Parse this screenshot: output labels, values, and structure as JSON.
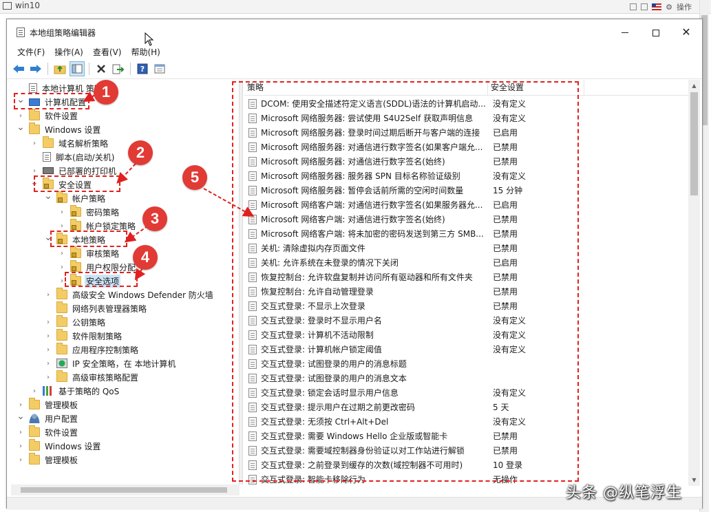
{
  "host": {
    "title": "win10",
    "menu_label": "操作"
  },
  "window": {
    "title": "本地组策略编辑器",
    "close_glyph": "✕"
  },
  "menu": [
    "文件(F)",
    "操作(A)",
    "查看(V)",
    "帮助(H)"
  ],
  "toolbar_icons": [
    "back-arrow-icon",
    "forward-arrow-icon",
    "up-folder-icon",
    "show-hide-tree-icon",
    "delete-icon",
    "export-icon",
    "help-icon",
    "properties-icon"
  ],
  "tree": [
    {
      "label": "本地计算机 策略",
      "depth": 0,
      "tw": "",
      "icon": "doc"
    },
    {
      "label": "计算机配置",
      "depth": 0,
      "tw": "v",
      "icon": "pc"
    },
    {
      "label": "软件设置",
      "depth": 1,
      "tw": ">",
      "icon": "folder"
    },
    {
      "label": "Windows 设置",
      "depth": 1,
      "tw": "v",
      "icon": "folder"
    },
    {
      "label": "域名解析策略",
      "depth": 2,
      "tw": ">",
      "icon": "folder"
    },
    {
      "label": "脚本(启动/关机)",
      "depth": 2,
      "tw": "",
      "icon": "doc"
    },
    {
      "label": "已部署的打印机",
      "depth": 2,
      "tw": ">",
      "icon": "printer"
    },
    {
      "label": "安全设置",
      "depth": 2,
      "tw": "v",
      "icon": "lockfold"
    },
    {
      "label": "帐户策略",
      "depth": 3,
      "tw": "v",
      "icon": "lockfold"
    },
    {
      "label": "密码策略",
      "depth": 4,
      "tw": ">",
      "icon": "lockfold"
    },
    {
      "label": "帐户锁定策略",
      "depth": 4,
      "tw": ">",
      "icon": "lockfold"
    },
    {
      "label": "本地策略",
      "depth": 3,
      "tw": "v",
      "icon": "lockfold"
    },
    {
      "label": "审核策略",
      "depth": 4,
      "tw": ">",
      "icon": "lockfold"
    },
    {
      "label": "用户权限分配",
      "depth": 4,
      "tw": ">",
      "icon": "lockfold"
    },
    {
      "label": "安全选项",
      "depth": 4,
      "tw": ">",
      "icon": "lockfold"
    },
    {
      "label": "高级安全 Windows Defender 防火墙",
      "depth": 3,
      "tw": ">",
      "icon": "folder"
    },
    {
      "label": "网络列表管理器策略",
      "depth": 3,
      "tw": "",
      "icon": "folder"
    },
    {
      "label": "公钥策略",
      "depth": 3,
      "tw": ">",
      "icon": "folder"
    },
    {
      "label": "软件限制策略",
      "depth": 3,
      "tw": ">",
      "icon": "folder"
    },
    {
      "label": "应用程序控制策略",
      "depth": 3,
      "tw": ">",
      "icon": "folder"
    },
    {
      "label": "IP 安全策略，在 本地计算机",
      "depth": 3,
      "tw": ">",
      "icon": "ipsec"
    },
    {
      "label": "高级审核策略配置",
      "depth": 3,
      "tw": ">",
      "icon": "folder"
    },
    {
      "label": "基于策略的 QoS",
      "depth": 2,
      "tw": ">",
      "icon": "qos"
    },
    {
      "label": "管理模板",
      "depth": 1,
      "tw": ">",
      "icon": "folder"
    },
    {
      "label": "用户配置",
      "depth": 0,
      "tw": "v",
      "icon": "user"
    },
    {
      "label": "软件设置",
      "depth": 1,
      "tw": ">",
      "icon": "folder"
    },
    {
      "label": "Windows 设置",
      "depth": 1,
      "tw": ">",
      "icon": "folder"
    },
    {
      "label": "管理模板",
      "depth": 1,
      "tw": ">",
      "icon": "folder"
    }
  ],
  "columns": {
    "policy": "策略",
    "setting": "安全设置"
  },
  "policies": [
    {
      "name": "DCOM: 使用安全描述符定义语言(SDDL)语法的计算机启动...",
      "value": "没有定义"
    },
    {
      "name": "Microsoft 网络服务器: 尝试使用 S4U2Self 获取声明信息",
      "value": "没有定义"
    },
    {
      "name": "Microsoft 网络服务器: 登录时间过期后断开与客户端的连接",
      "value": "已启用"
    },
    {
      "name": "Microsoft 网络服务器: 对通信进行数字签名(如果客户端允...",
      "value": "已禁用"
    },
    {
      "name": "Microsoft 网络服务器: 对通信进行数字签名(始终)",
      "value": "已禁用"
    },
    {
      "name": "Microsoft 网络服务器: 服务器 SPN 目标名称验证级别",
      "value": "没有定义"
    },
    {
      "name": "Microsoft 网络服务器: 暂停会话前所需的空闲时间数量",
      "value": "15 分钟"
    },
    {
      "name": "Microsoft 网络客户端: 对通信进行数字签名(如果服务器允...",
      "value": "已启用"
    },
    {
      "name": "Microsoft 网络客户端: 对通信进行数字签名(始终)",
      "value": "已禁用"
    },
    {
      "name": "Microsoft 网络客户端: 将未加密的密码发送到第三方 SMB...",
      "value": "已禁用"
    },
    {
      "name": "关机: 清除虚拟内存页面文件",
      "value": "已禁用"
    },
    {
      "name": "关机: 允许系统在未登录的情况下关闭",
      "value": "已启用"
    },
    {
      "name": "恢复控制台: 允许软盘复制并访问所有驱动器和所有文件夹",
      "value": "已禁用"
    },
    {
      "name": "恢复控制台: 允许自动管理登录",
      "value": "已禁用"
    },
    {
      "name": "交互式登录: 不显示上次登录",
      "value": "已禁用"
    },
    {
      "name": "交互式登录: 登录时不显示用户名",
      "value": "没有定义"
    },
    {
      "name": "交互式登录: 计算机不活动限制",
      "value": "没有定义"
    },
    {
      "name": "交互式登录: 计算机帐户锁定阈值",
      "value": "没有定义"
    },
    {
      "name": "交互式登录: 试图登录的用户的消息标题",
      "value": ""
    },
    {
      "name": "交互式登录: 试图登录的用户的消息文本",
      "value": ""
    },
    {
      "name": "交互式登录: 锁定会话时显示用户信息",
      "value": "没有定义"
    },
    {
      "name": "交互式登录: 提示用户在过期之前更改密码",
      "value": "5 天"
    },
    {
      "name": "交互式登录: 无须按 Ctrl+Alt+Del",
      "value": "没有定义"
    },
    {
      "name": "交互式登录: 需要 Windows Hello 企业版或智能卡",
      "value": "已禁用"
    },
    {
      "name": "交互式登录: 需要域控制器身份验证以对工作站进行解锁",
      "value": "已禁用"
    },
    {
      "name": "交互式登录: 之前登录到缓存的次数(域控制器不可用时)",
      "value": "10 登录"
    },
    {
      "name": "交互式登录: 智能卡移除行为",
      "value": "无操作"
    }
  ],
  "annotations": [
    "1",
    "2",
    "3",
    "4",
    "5"
  ],
  "annotation_color": "#e02020",
  "watermark": "头条 @纵笔浮生"
}
